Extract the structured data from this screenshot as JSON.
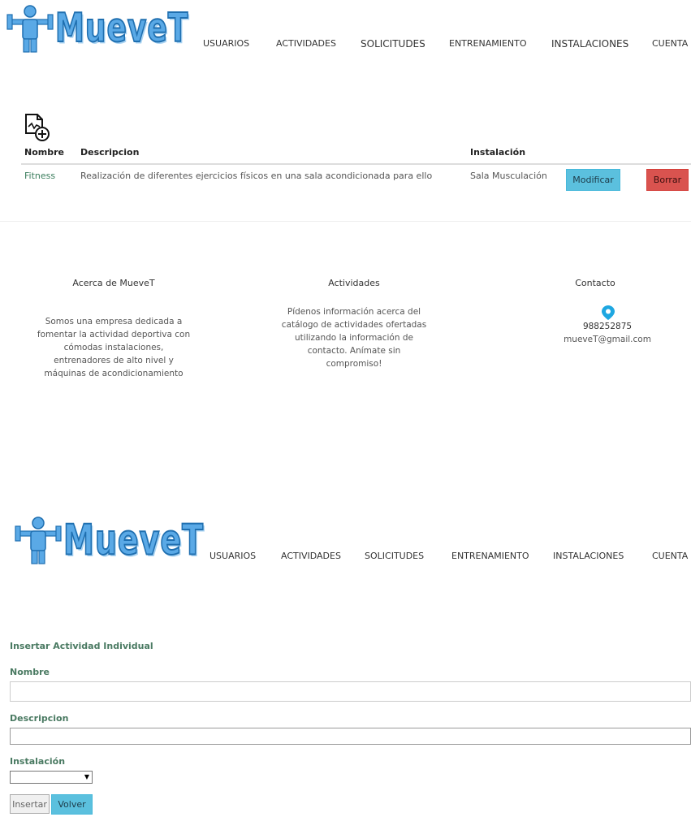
{
  "brand": {
    "name": "MueveT"
  },
  "nav": [
    "USUARIOS",
    "ACTIVIDADES",
    "SOLICITUDES",
    "ENTRENAMIENTO",
    "INSTALACIONES",
    "CUENTA"
  ],
  "table": {
    "headers": [
      "Nombre",
      "Descripcion",
      "Instalación"
    ],
    "rows": [
      {
        "nombre": "Fitness",
        "descripcion": "Realización de diferentes ejercicios físicos en una sala acondicionada para ello",
        "instalacion": "Sala Musculación",
        "modify_label": "Modificar",
        "delete_label": "Borrar"
      }
    ],
    "add_icon": "file-add-icon"
  },
  "footer": {
    "about": {
      "title": "Acerca de MueveT",
      "lines": [
        "Somos una empresa dedicada a",
        "fomentar la actividad deportiva con",
        "cómodas instalaciones,",
        "entrenadores de alto nivel y",
        "máquinas de acondicionamiento"
      ]
    },
    "activities": {
      "title": "Actividades",
      "lines": [
        "Pídenos información acerca del",
        "catálogo de actividades ofertadas",
        "utilizando la información de",
        "contacto. Anímate sin",
        "compromiso!"
      ]
    },
    "contact": {
      "title": "Contacto",
      "icon": "location-pin-icon",
      "phone": "988252875",
      "email": "mueveT@gmail.com"
    }
  },
  "form": {
    "title": "Insertar Actividad Individual",
    "nombre_label": "Nombre",
    "descripcion_label": "Descripcion",
    "instalacion_label": "Instalación",
    "insert_label": "Insertar",
    "back_label": "Volver"
  },
  "colors": {
    "accent_blue": "#5bc0de",
    "danger_red": "#d9534f",
    "link_green": "#3a7d5c",
    "logo_blue": "#5aa9e6"
  }
}
